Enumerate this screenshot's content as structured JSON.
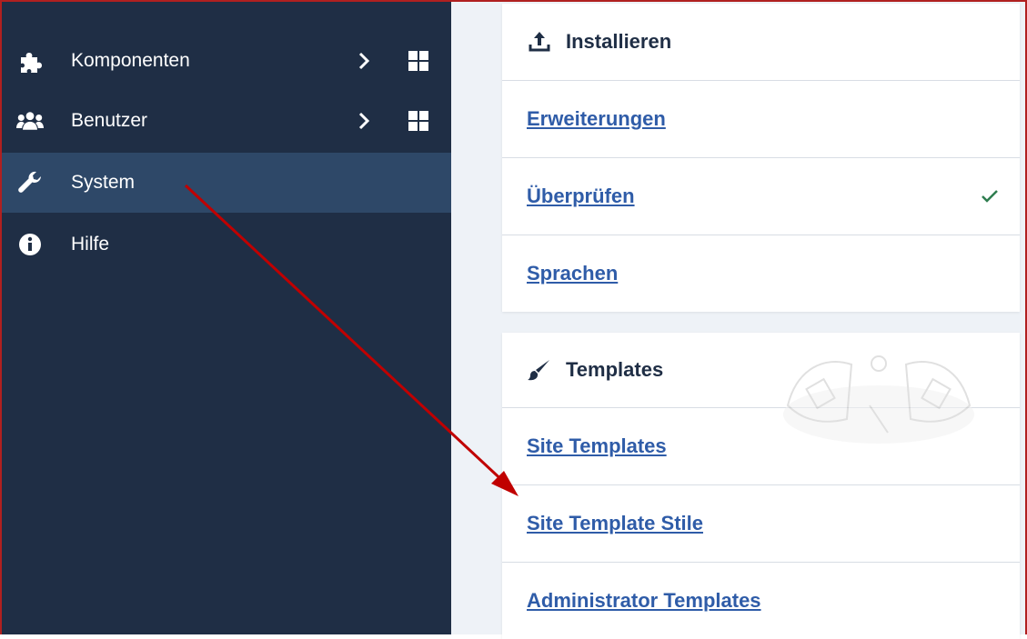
{
  "sidebar": {
    "items": [
      {
        "label": "Komponenten",
        "icon": "puzzle-icon",
        "has_submenu": true
      },
      {
        "label": "Benutzer",
        "icon": "users-icon",
        "has_submenu": true
      },
      {
        "label": "System",
        "icon": "wrench-icon",
        "active": true
      },
      {
        "label": "Hilfe",
        "icon": "info-icon"
      }
    ]
  },
  "install_card": {
    "title": "Installieren",
    "icon": "upload-icon",
    "links": [
      {
        "label": "Erweiterungen"
      },
      {
        "label": "Überprüfen",
        "status": "check-icon"
      },
      {
        "label": "Sprachen"
      }
    ]
  },
  "templates_card": {
    "title": "Templates",
    "icon": "brush-icon",
    "links": [
      {
        "label": "Site Templates"
      },
      {
        "label": "Site Template Stile"
      },
      {
        "label": "Administrator Templates"
      }
    ]
  },
  "colors": {
    "sidebar_bg": "#1f2e45",
    "sidebar_active": "#2e4868",
    "link": "#2f5ca8",
    "annotation_arrow": "#c00000",
    "check": "#2e7d4f"
  }
}
